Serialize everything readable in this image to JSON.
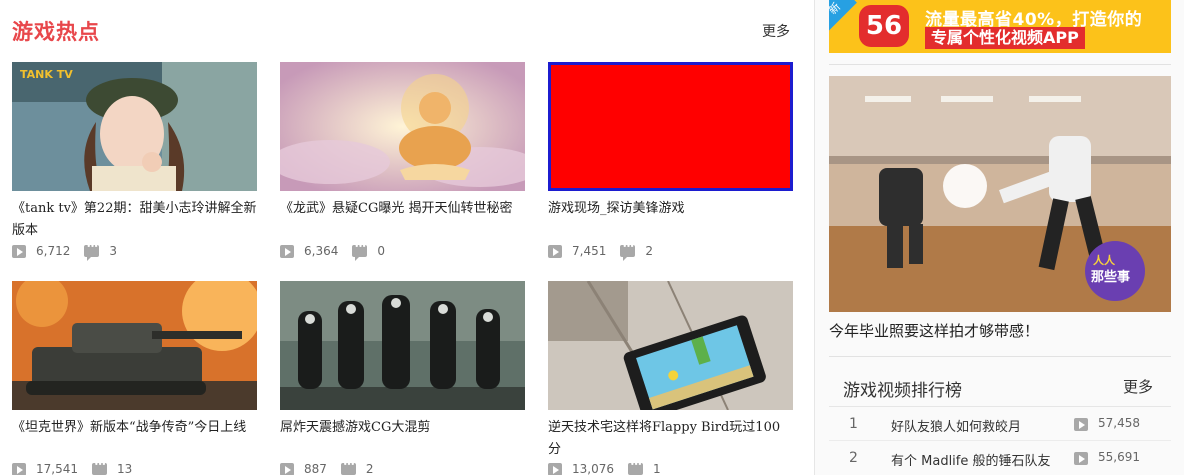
{
  "section": {
    "title": "游戏热点",
    "more": "更多"
  },
  "cards": [
    {
      "title": "《tank tv》第22期：甜美小志玲讲解全新版本",
      "views": "6,712",
      "comments": "3",
      "thumb": "tank-tv-girl"
    },
    {
      "title": "《龙武》悬疑CG曝光 揭开天仙转世秘密",
      "views": "6,364",
      "comments": "0",
      "thumb": "buddha"
    },
    {
      "title": "游戏现场_探访美锋游戏",
      "views": "7,451",
      "comments": "2",
      "thumb": "red-placeholder"
    },
    {
      "title": "《坦克世界》新版本“战争传奇”今日上线",
      "views": "17,541",
      "comments": "13",
      "thumb": "tank"
    },
    {
      "title": "屌炸天震撼游戏CG大混剪",
      "views": "887",
      "comments": "2",
      "thumb": "nuns"
    },
    {
      "title": "逆天技术宅这样将Flappy Bird玩过100分",
      "views": "13,076",
      "comments": "1",
      "thumb": "flappy-tablet"
    }
  ],
  "sidebar": {
    "banner": {
      "tag": "新",
      "logo": "56",
      "line1": "流量最高省40%，打造你的",
      "line2": "专属个性化视频APP"
    },
    "feature": {
      "title": "今年毕业照要这样拍才够带感！",
      "badge": "人人那些事"
    },
    "ranking": {
      "title": "游戏视频排行榜",
      "more": "更多",
      "items": [
        {
          "rank": "1",
          "name": "好队友狼人如何救皎月",
          "views": "57,458"
        },
        {
          "rank": "2",
          "name": "有个 Madlife 般的锤石队友",
          "views": "55,691"
        }
      ]
    }
  },
  "colors": {
    "accent": "#e8474b",
    "banner_bg": "#fcc21a",
    "logo_red": "#e32d2d"
  }
}
